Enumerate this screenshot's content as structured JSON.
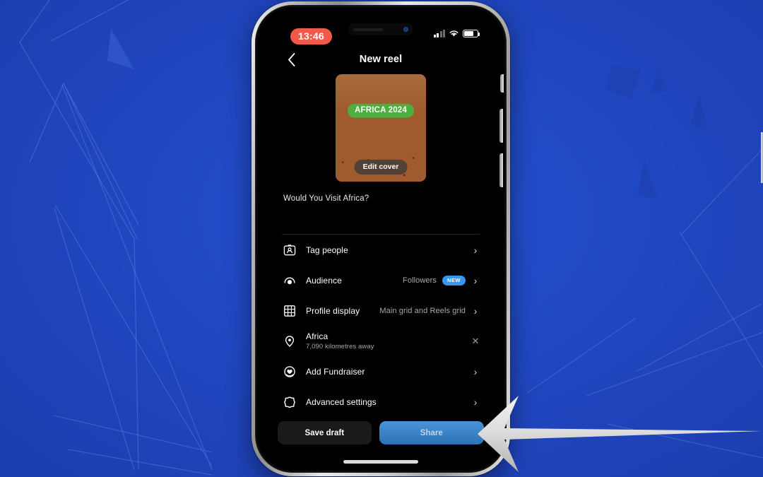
{
  "background": {
    "color": "#1f44bc",
    "accent_line_color": "#4a73d8"
  },
  "phone": {
    "status_bar": {
      "time": "13:46",
      "time_pill_color": "#f2594a",
      "signal_icon": "cellular-signal-icon",
      "wifi_icon": "wifi-icon",
      "battery_icon": "battery-icon"
    },
    "nav": {
      "back_icon": "chevron-left-icon",
      "title": "New reel"
    },
    "cover": {
      "overlay_title": "AFRICA 2024",
      "overlay_title_color": "#4caf3e",
      "edit_button_label": "Edit cover"
    },
    "caption": {
      "text": "Would You Visit Africa?"
    },
    "options": [
      {
        "icon": "tag-people-icon",
        "label": "Tag people",
        "value": "",
        "badge": "",
        "sub": "",
        "accessory": "chevron"
      },
      {
        "icon": "audience-icon",
        "label": "Audience",
        "value": "Followers",
        "badge": "NEW",
        "sub": "",
        "accessory": "chevron"
      },
      {
        "icon": "profile-grid-icon",
        "label": "Profile display",
        "value": "Main grid and Reels grid",
        "badge": "",
        "sub": "",
        "accessory": "chevron"
      },
      {
        "icon": "location-pin-icon",
        "label": "Africa",
        "value": "",
        "badge": "",
        "sub": "7,090 kilometres away",
        "accessory": "close"
      },
      {
        "icon": "fundraiser-heart-icon",
        "label": "Add Fundraiser",
        "value": "",
        "badge": "",
        "sub": "",
        "accessory": "chevron"
      },
      {
        "icon": "advanced-settings-icon",
        "label": "Advanced settings",
        "value": "",
        "badge": "",
        "sub": "",
        "accessory": "chevron"
      }
    ],
    "bottom": {
      "save_draft_label": "Save draft",
      "share_label": "Share",
      "share_color": "#3a83c6"
    }
  },
  "annotation": {
    "pointer_icon": "left-arrow-pointer",
    "pointer_color": "#d8d8d8",
    "points_at": "share-button"
  }
}
